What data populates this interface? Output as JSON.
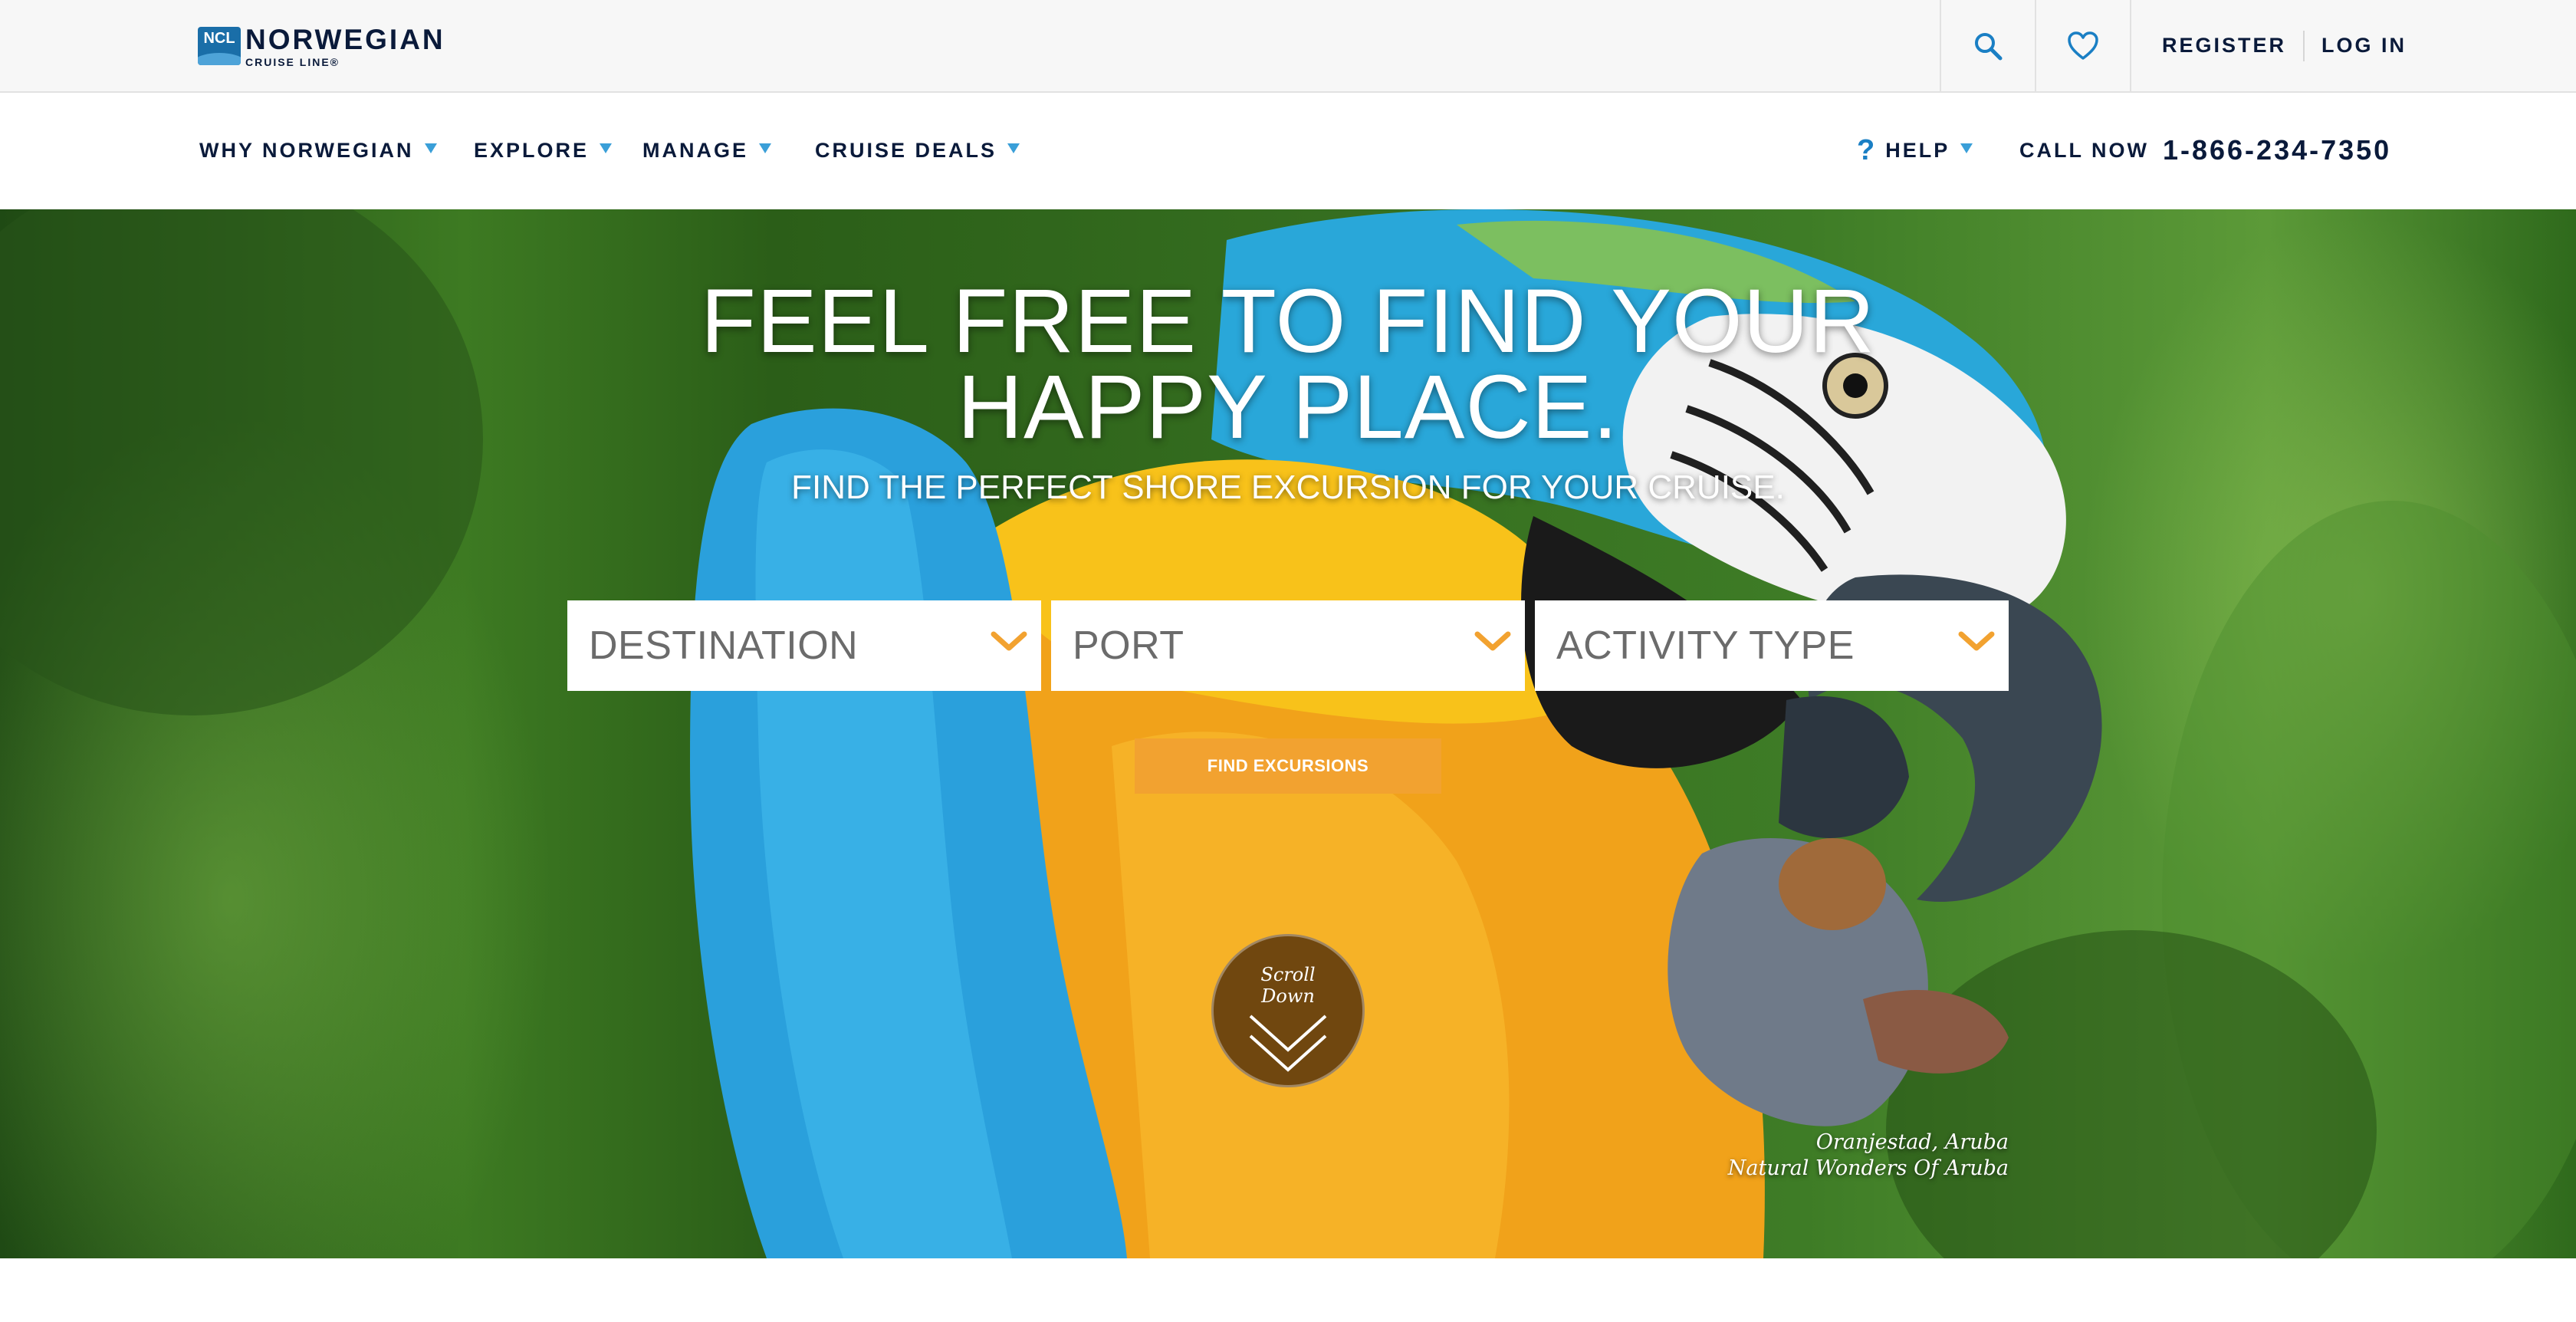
{
  "brand": {
    "badge": "NCL",
    "name": "NORWEGIAN",
    "sub": "CRUISE LINE®"
  },
  "utility": {
    "register": "REGISTER",
    "login": "LOG IN",
    "search_icon": "search-icon",
    "favorites_icon": "heart-icon"
  },
  "nav": {
    "items": [
      {
        "label": "WHY NORWEGIAN"
      },
      {
        "label": "EXPLORE"
      },
      {
        "label": "MANAGE"
      },
      {
        "label": "CRUISE DEALS"
      }
    ],
    "help": "HELP",
    "help_icon": "?",
    "call_label": "CALL NOW",
    "phone": "1-866-234-7350"
  },
  "hero": {
    "title_line1": "FEEL FREE TO FIND YOUR",
    "title_line2": "HAPPY PLACE.",
    "subtitle": "FIND THE PERFECT SHORE EXCURSION FOR YOUR CRUISE.",
    "selects": [
      {
        "value": "DESTINATION"
      },
      {
        "value": "PORT"
      },
      {
        "value": "ACTIVITY TYPE"
      }
    ],
    "button": "FIND EXCURSIONS",
    "scroll_line1": "Scroll",
    "scroll_line2": "Down",
    "caption_line1": "Oranjestad, Aruba",
    "caption_line2": "Natural Wonders Of Aruba"
  },
  "colors": {
    "navy": "#0a1a3a",
    "accent_blue": "#3a9fd8",
    "cta_orange": "#f2a230",
    "chevron_orange": "#f2a230"
  }
}
